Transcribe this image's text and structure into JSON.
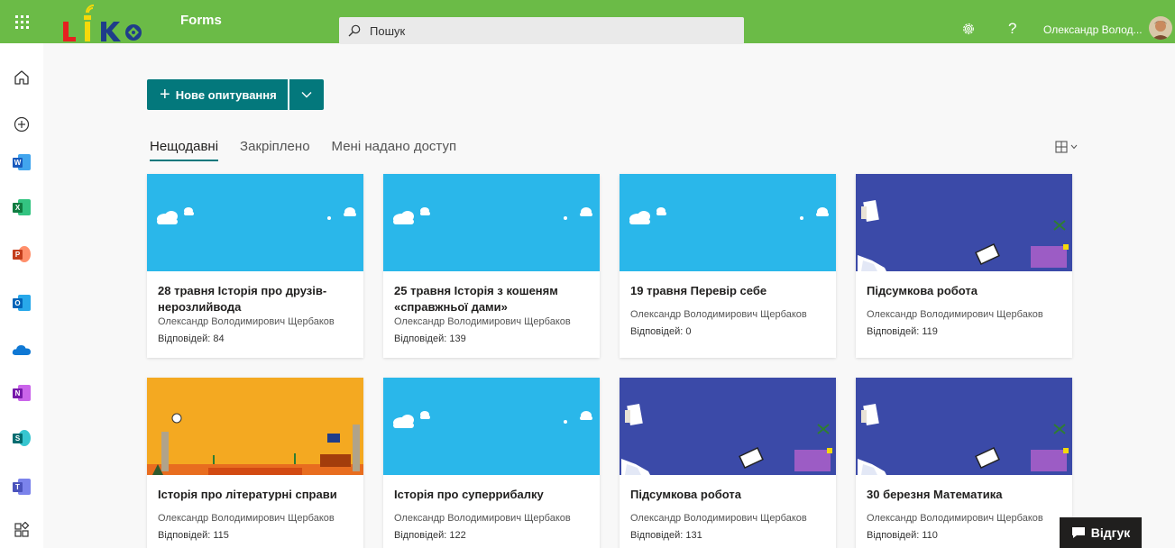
{
  "header": {
    "app_name": "Forms",
    "search_placeholder": "Пошук",
    "help_label": "?",
    "user_name": "Олександр Волод..."
  },
  "toolbar": {
    "new_label": "Нове опитування"
  },
  "tabs": [
    {
      "label": "Нещодавні",
      "active": true
    },
    {
      "label": "Закріплено",
      "active": false
    },
    {
      "label": "Мені надано доступ",
      "active": false
    }
  ],
  "cards": [
    {
      "title": "28 травня Історія про друзів-нерозлийвода",
      "author": "Олександр Володимирович Щербаков",
      "responses": "Відповідей: 84",
      "theme": "sky"
    },
    {
      "title": "25 травня Історія з кошеням «справжньої дами»",
      "author": "Олександр Володимирович Щербаков",
      "responses": "Відповідей: 139",
      "theme": "sky"
    },
    {
      "title": "19 травня Перевір себе",
      "author": "Олександр Володимирович Щербаков",
      "responses": "Відповідей: 0",
      "theme": "sky"
    },
    {
      "title": "Підсумкова робота",
      "author": "Олександр Володимирович Щербаков",
      "responses": "Відповідей: 119",
      "theme": "indigo"
    },
    {
      "title": "Історія про літературні справи",
      "author": "Олександр Володимирович Щербаков",
      "responses": "Відповідей: 115",
      "theme": "orange"
    },
    {
      "title": "Історія про суперрибалку",
      "author": "Олександр Володимирович Щербаков",
      "responses": "Відповідей: 122",
      "theme": "sky"
    },
    {
      "title": "Підсумкова робота",
      "author": "Олександр Володимирович Щербаков",
      "responses": "Відповідей: 131",
      "theme": "indigo"
    },
    {
      "title": "30 березня Математика",
      "author": "Олександр Володимирович Щербаков",
      "responses": "Відповідей: 110",
      "theme": "indigo"
    }
  ],
  "feedback_label": "Відгук",
  "colors": {
    "topbar": "#6bbb47",
    "accent": "#03787c",
    "sky": "#2ab7ea",
    "indigo": "#3b4aa8",
    "orange": "#f4a921"
  }
}
